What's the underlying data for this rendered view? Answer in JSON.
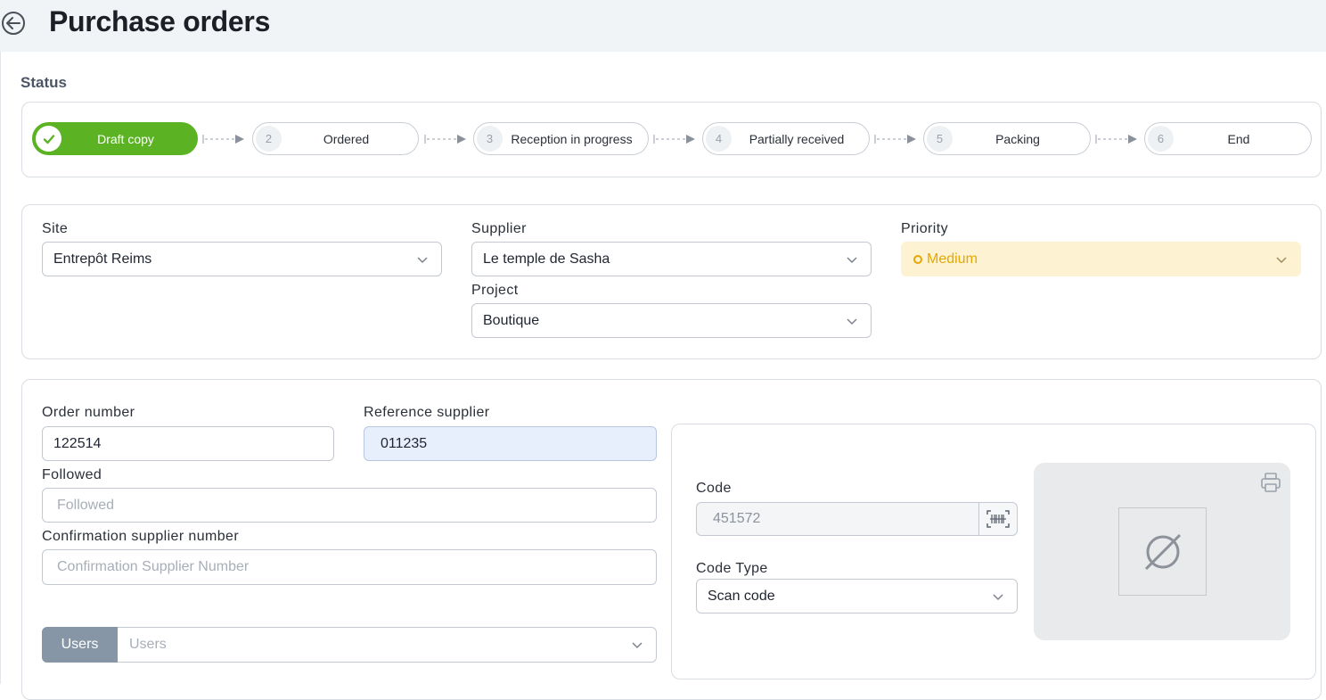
{
  "header": {
    "title": "Purchase orders"
  },
  "status": {
    "label": "Status",
    "steps": [
      {
        "num": "1",
        "label": "Draft copy"
      },
      {
        "num": "2",
        "label": "Ordered"
      },
      {
        "num": "3",
        "label": "Reception in progress"
      },
      {
        "num": "4",
        "label": "Partially received"
      },
      {
        "num": "5",
        "label": "Packing"
      },
      {
        "num": "6",
        "label": "End"
      }
    ],
    "active_step": 1
  },
  "general": {
    "site": {
      "label": "Site",
      "value": "Entrepôt Reims"
    },
    "supplier": {
      "label": "Supplier",
      "value": "Le temple de Sasha"
    },
    "project": {
      "label": "Project",
      "value": "Boutique"
    },
    "priority": {
      "label": "Priority",
      "value": "Medium"
    }
  },
  "details": {
    "order_number": {
      "label": "Order number",
      "value": "122514"
    },
    "reference_supplier": {
      "label": "Reference supplier",
      "value": "011235"
    },
    "followed": {
      "label": "Followed",
      "placeholder": "Followed"
    },
    "confirmation": {
      "label": "Confirmation supplier number",
      "placeholder": "Confirmation Supplier Number"
    },
    "users": {
      "tag": "Users",
      "placeholder": "Users"
    }
  },
  "code": {
    "code": {
      "label": "Code",
      "value": "451572"
    },
    "code_type": {
      "label": "Code Type",
      "value": "Scan code"
    }
  },
  "colors": {
    "accent_green": "#5bb324",
    "priority_bg": "#fdf3d3",
    "priority_text": "#e6a700",
    "users_tag": "#8796a6"
  }
}
